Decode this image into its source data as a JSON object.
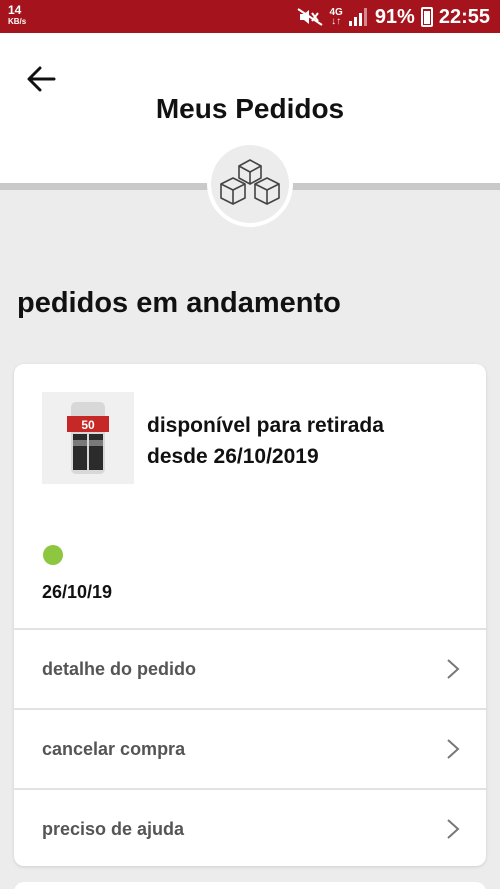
{
  "status_bar": {
    "speed_value": "14",
    "speed_unit": "KB/s",
    "network": "4G",
    "battery": "91%",
    "time": "22:55"
  },
  "header": {
    "title": "Meus Pedidos"
  },
  "section": {
    "title": "pedidos em andamento"
  },
  "order": {
    "status_line1": "disponível para retirada",
    "status_line2": "desde 26/10/2019",
    "status_color": "#8dc63f",
    "date": "26/10/19",
    "thumbnail_badge": "50"
  },
  "actions": [
    {
      "label": "detalhe do pedido"
    },
    {
      "label": "cancelar compra"
    },
    {
      "label": "preciso de ajuda"
    }
  ],
  "colors": {
    "status_bar": "#a5141c",
    "background": "#ececec"
  }
}
